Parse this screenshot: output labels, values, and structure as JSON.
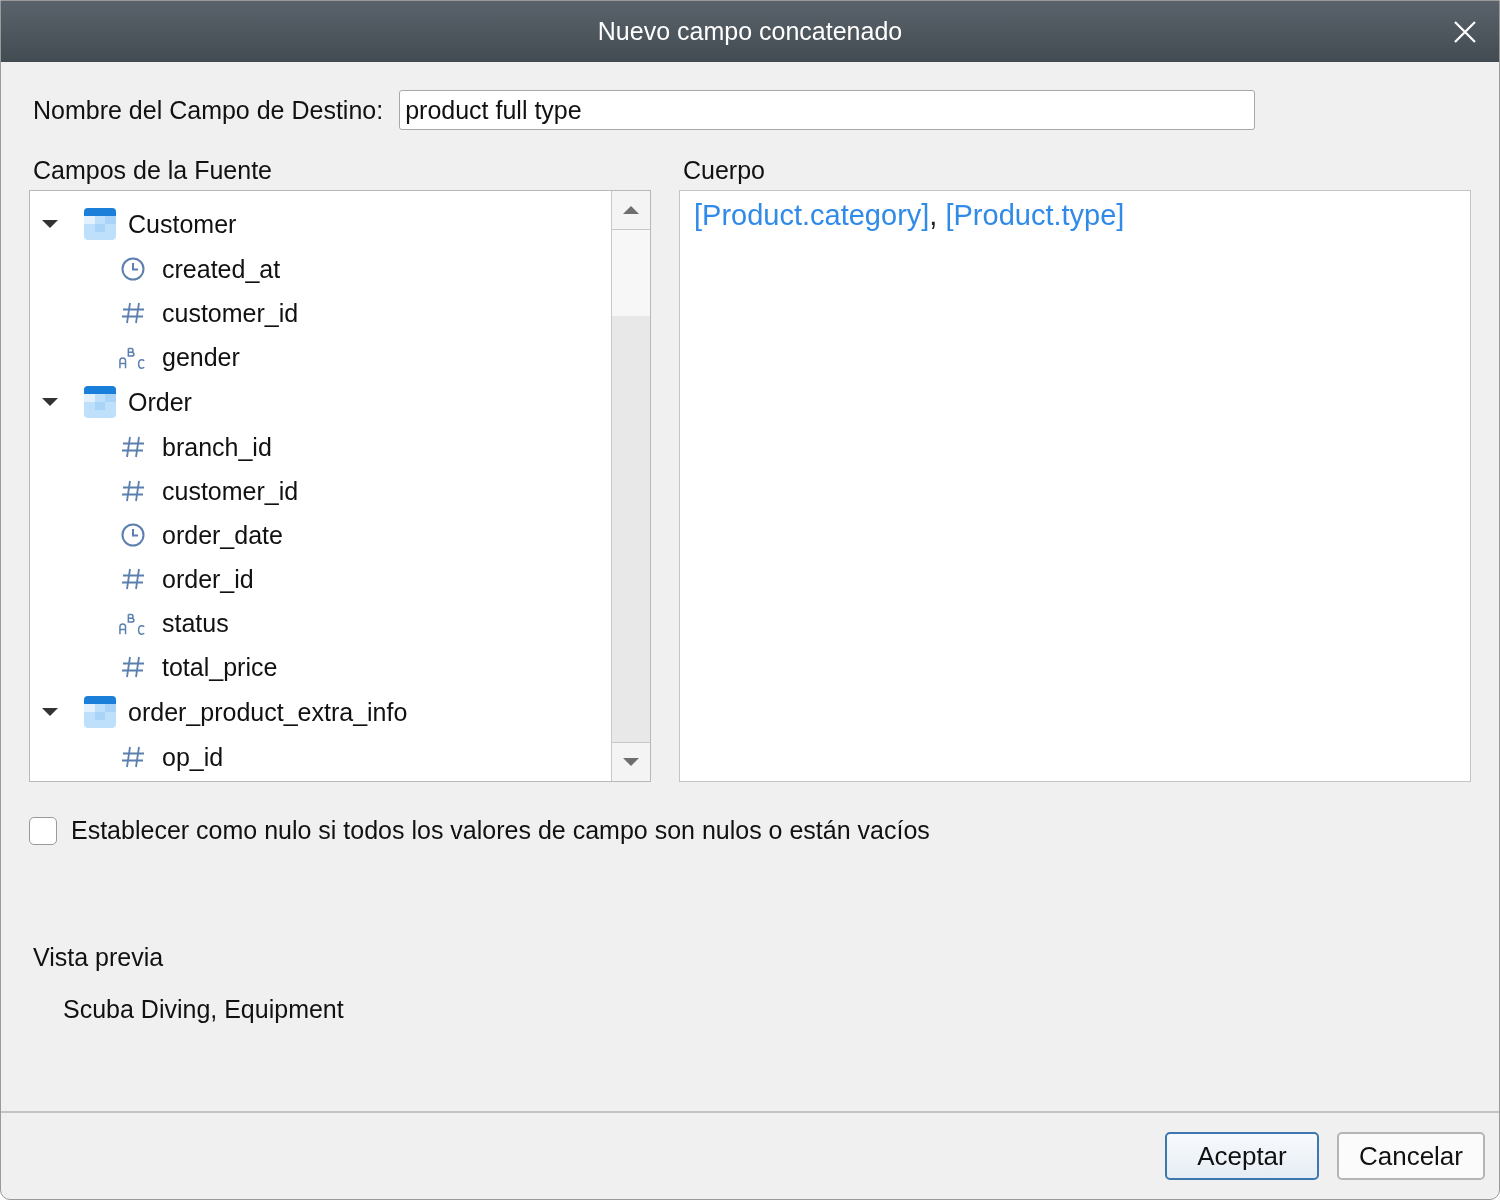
{
  "window": {
    "title": "Nuevo campo concatenado"
  },
  "target_field": {
    "label": "Nombre del Campo de Destino:",
    "value": "product full type"
  },
  "source_fields": {
    "label": "Campos de la Fuente",
    "tables": [
      {
        "name": "Customer",
        "expanded": true,
        "children": [
          {
            "name": "created_at",
            "kind": "date"
          },
          {
            "name": "customer_id",
            "kind": "number"
          },
          {
            "name": "gender",
            "kind": "text"
          }
        ]
      },
      {
        "name": "Order",
        "expanded": true,
        "children": [
          {
            "name": "branch_id",
            "kind": "number"
          },
          {
            "name": "customer_id",
            "kind": "number"
          },
          {
            "name": "order_date",
            "kind": "date"
          },
          {
            "name": "order_id",
            "kind": "number"
          },
          {
            "name": "status",
            "kind": "text"
          },
          {
            "name": "total_price",
            "kind": "number"
          }
        ]
      },
      {
        "name": "order_product_extra_info",
        "expanded": true,
        "children": [
          {
            "name": "op_id",
            "kind": "number"
          }
        ]
      }
    ]
  },
  "body": {
    "label": "Cuerpo",
    "tokens": [
      {
        "text": "[Product.category]",
        "kind": "field"
      },
      {
        "text": ",",
        "kind": "text"
      },
      {
        "text": "[Product.type]",
        "kind": "field"
      }
    ]
  },
  "null_option": {
    "label": "Establecer como nulo si todos los valores de campo son nulos o están vacíos",
    "checked": false
  },
  "preview": {
    "label": "Vista previa",
    "value": "Scuba Diving, Equipment"
  },
  "buttons": [
    {
      "label": "Aceptar",
      "default": true
    },
    {
      "label": "Cancelar",
      "default": false
    }
  ]
}
